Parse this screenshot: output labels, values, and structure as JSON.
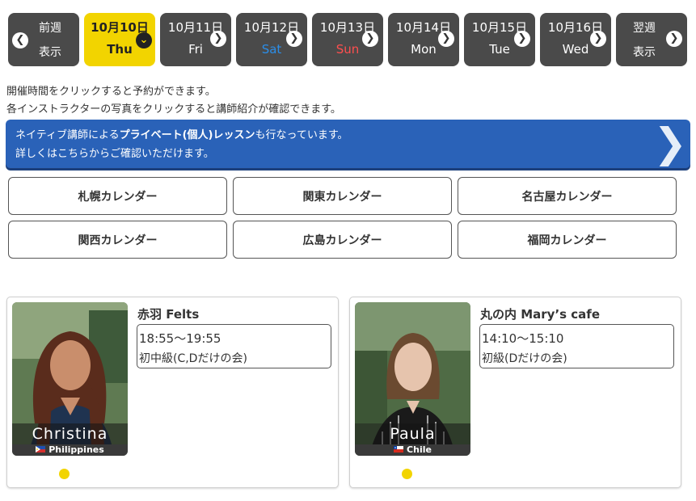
{
  "day_nav": {
    "prev": {
      "line1": "前週",
      "line2": "表示"
    },
    "days": [
      {
        "date": "10月10日",
        "dow": "Thu",
        "active": true
      },
      {
        "date": "10月11日",
        "dow": "Fri"
      },
      {
        "date": "10月12日",
        "dow": "Sat"
      },
      {
        "date": "10月13日",
        "dow": "Sun"
      },
      {
        "date": "10月14日",
        "dow": "Mon"
      },
      {
        "date": "10月15日",
        "dow": "Tue"
      },
      {
        "date": "10月16日",
        "dow": "Wed"
      }
    ],
    "next": {
      "line1": "翌週",
      "line2": "表示"
    }
  },
  "notes": {
    "line1": "開催時間をクリックすると予約ができます。",
    "line2": "各インストラクターの写真をクリックすると講師紹介が確認できます。"
  },
  "banner": {
    "line1_pre": "ネイティブ講師による",
    "line1_bold": "プライベート(個人)レッスン",
    "line1_post": "も行なっています。",
    "line2": "詳しくはこちらからご確認いただけます。"
  },
  "calendars": [
    "札幌カレンダー",
    "関東カレンダー",
    "名古屋カレンダー",
    "関西カレンダー",
    "広島カレンダー",
    "福岡カレンダー"
  ],
  "lessons": [
    {
      "instructor": "Christina",
      "country": "Philippines",
      "venue": "赤羽 Felts",
      "time": "18:55～19:55",
      "level": "初中級(C,Dだけの会)"
    },
    {
      "instructor": "Paula",
      "country": "Chile",
      "venue": "丸の内 Mary’s cafe",
      "time": "14:10～15:10",
      "level": "初級(Dだけの会)"
    }
  ],
  "colors": {
    "active_day": "#f2d400",
    "day_bg": "#4a4a4a",
    "banner": "#2a62b8",
    "saturday": "#2b8ee8",
    "sunday": "#ff4f4f"
  }
}
